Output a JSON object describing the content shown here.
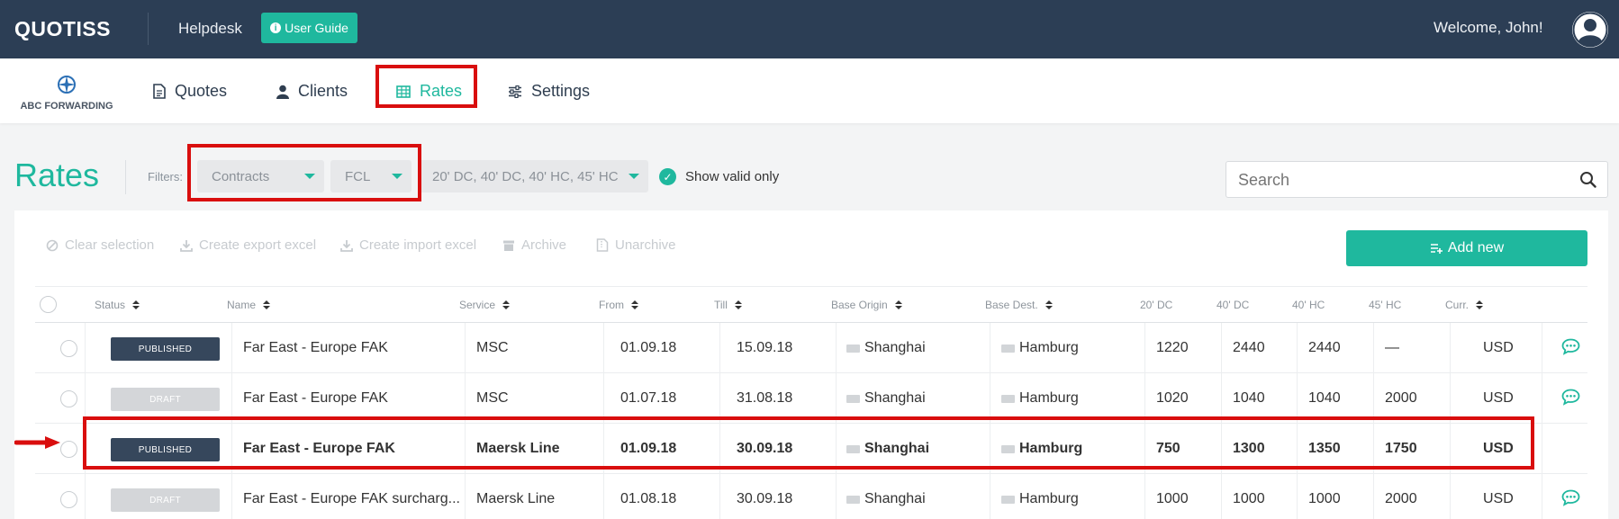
{
  "topbar": {
    "logo": "QUOTISS",
    "helpdesk": "Helpdesk",
    "user_guide": "User Guide",
    "welcome": "Welcome, John!"
  },
  "nav": {
    "brand": "ABC FORWARDING",
    "items": [
      {
        "label": "Quotes",
        "icon": "document-icon"
      },
      {
        "label": "Clients",
        "icon": "user-icon"
      },
      {
        "label": "Rates",
        "icon": "table-icon",
        "active": true
      },
      {
        "label": "Settings",
        "icon": "sliders-icon"
      }
    ]
  },
  "page": {
    "title": "Rates",
    "filters_label": "Filters:",
    "filter_type": "Contracts",
    "filter_mode": "FCL",
    "filter_containers": "20' DC, 40' DC, 40' HC, 45' HC",
    "show_valid_label": "Show valid only",
    "search_placeholder": "Search"
  },
  "toolbar": {
    "clear_selection": "Clear selection",
    "create_export": "Create export excel",
    "create_import": "Create import excel",
    "archive": "Archive",
    "unarchive": "Unarchive",
    "add_new": "Add new"
  },
  "table": {
    "headers": {
      "status": "Status",
      "name": "Name",
      "service": "Service",
      "from": "From",
      "till": "Till",
      "origin": "Base Origin",
      "dest": "Base Dest.",
      "dc20": "20' DC",
      "dc40": "40' DC",
      "hc40": "40' HC",
      "hc45": "45' HC",
      "curr": "Curr."
    },
    "rows": [
      {
        "status": "PUBLISHED",
        "name": "Far East - Europe FAK",
        "service": "MSC",
        "from": "01.09.18",
        "till": "15.09.18",
        "origin": "Shanghai",
        "dest": "Hamburg",
        "dc20": "1220",
        "dc40": "2440",
        "hc40": "2440",
        "hc45": "—",
        "curr": "USD"
      },
      {
        "status": "DRAFT",
        "name": "Far East - Europe FAK",
        "service": "MSC",
        "from": "01.07.18",
        "till": "31.08.18",
        "origin": "Shanghai",
        "dest": "Hamburg",
        "dc20": "1020",
        "dc40": "1040",
        "hc40": "1040",
        "hc45": "2000",
        "curr": "USD"
      },
      {
        "status": "PUBLISHED",
        "name": "Far East - Europe FAK",
        "service": "Maersk Line",
        "from": "01.09.18",
        "till": "30.09.18",
        "origin": "Shanghai",
        "dest": "Hamburg",
        "dc20": "750",
        "dc40": "1300",
        "hc40": "1350",
        "hc45": "1750",
        "curr": "USD"
      },
      {
        "status": "DRAFT",
        "name": "Far East - Europe FAK surcharg...",
        "service": "Maersk Line",
        "from": "01.08.18",
        "till": "30.09.18",
        "origin": "Shanghai",
        "dest": "Hamburg",
        "dc20": "1000",
        "dc40": "1000",
        "hc40": "1000",
        "hc45": "2000",
        "curr": "USD"
      }
    ]
  },
  "colors": {
    "topbar": "#2c3e55",
    "accent": "#1fb89e",
    "published": "#36475c",
    "draft": "#d4d6d9",
    "highlight": "#d90e0e"
  }
}
